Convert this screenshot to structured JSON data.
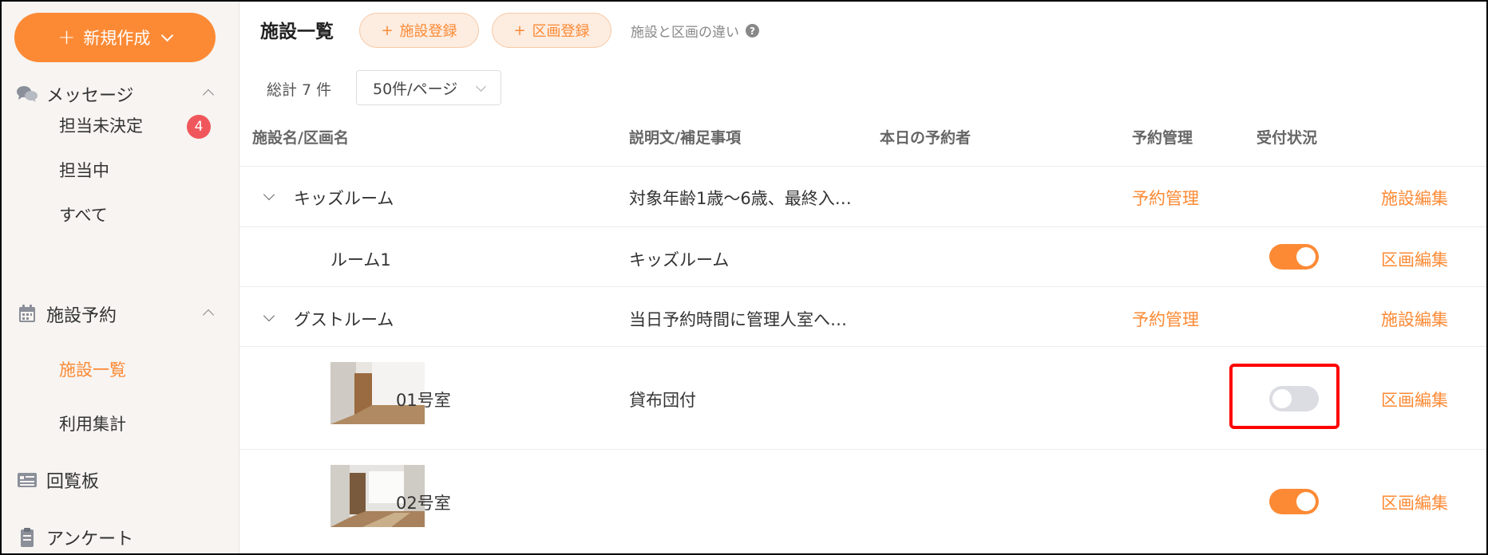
{
  "sidebar": {
    "new_button": {
      "plus": "+",
      "label": "新規作成"
    },
    "groups": [
      {
        "label": "メッセージ",
        "items": [
          {
            "label": "担当未決定",
            "badge": "4"
          },
          {
            "label": "担当中"
          },
          {
            "label": "すべて"
          }
        ]
      },
      {
        "label": "施設予約",
        "items": [
          {
            "label": "施設一覧",
            "active": true
          },
          {
            "label": "利用集計"
          }
        ]
      },
      {
        "label": "回覧板"
      },
      {
        "label": "アンケート"
      }
    ]
  },
  "header": {
    "title": "施設一覧",
    "facility_register": {
      "plus": "+",
      "label": "施設登録"
    },
    "section_register": {
      "plus": "+",
      "label": "区画登録"
    },
    "difference_link": "施設と区画の違い",
    "help_glyph": "?"
  },
  "listing": {
    "total_text": "総計 7 件",
    "per_page": "50件/ページ"
  },
  "table": {
    "columns": [
      "施設名/区画名",
      "説明文/補足事項",
      "本日の予約者",
      "予約管理",
      "受付状況"
    ],
    "rows": [
      {
        "type": "facility",
        "name": "キッズルーム",
        "description": "対象年齢1歳〜6歳、最終入…",
        "manage": "予約管理",
        "edit": "施設編集"
      },
      {
        "type": "section",
        "name": "ルーム1",
        "description": "キッズルーム",
        "accepting": true,
        "edit": "区画編集"
      },
      {
        "type": "facility",
        "name": "グストルーム",
        "description": "当日予約時間に管理人室へ…",
        "manage": "予約管理",
        "edit": "施設編集"
      },
      {
        "type": "section",
        "name": "01号室",
        "description": "貸布団付",
        "accepting": false,
        "edit": "区画編集",
        "highlighted": true
      },
      {
        "type": "section",
        "name": "02号室",
        "description": "",
        "accepting": true,
        "edit": "区画編集"
      }
    ]
  },
  "colors": {
    "accent": "#fc8a35",
    "badge": "#f0575c",
    "toggle_off": "#dcdde3",
    "highlight": "#ff0000"
  }
}
